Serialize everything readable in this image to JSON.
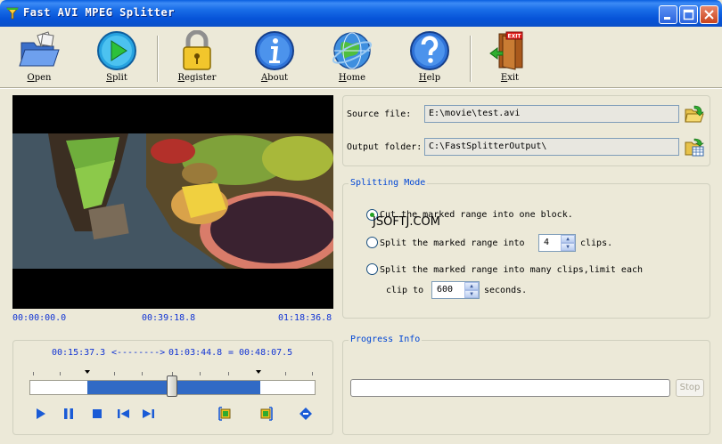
{
  "window": {
    "title": "Fast AVI MPEG Splitter"
  },
  "toolbar": {
    "open": "Open",
    "split": "Split",
    "register": "Register",
    "about": "About",
    "home": "Home",
    "help": "Help",
    "exit": "Exit",
    "exit_sign": "EXIT"
  },
  "player": {
    "time_start": "00:00:00.0",
    "time_current": "00:39:18.8",
    "time_end": "01:18:36.8"
  },
  "files": {
    "source_label": "Source file:",
    "source_value": "E:\\movie\\test.avi",
    "output_label": "Output folder:",
    "output_value": "C:\\FastSplitterOutput\\"
  },
  "mode": {
    "legend": "Splitting Mode",
    "opt1": "Cut the marked range into one block.",
    "opt2_prefix": "Split the marked range into",
    "opt2_value": "4",
    "opt2_suffix": "clips.",
    "opt3_line1": "Split the marked range into many clips,limit each",
    "opt3_prefix": "clip to",
    "opt3_value": "600",
    "opt3_suffix": "seconds.",
    "selected": 1
  },
  "watermark": "JSOFTJ.COM",
  "range": {
    "start": "00:15:37.3",
    "arrow": "<-------->",
    "end": "01:03:44.8",
    "eq": "=",
    "length": "00:48:07.5"
  },
  "progress": {
    "legend": "Progress Info",
    "stop_label": "Stop",
    "value": 0
  },
  "colors": {
    "accent": "#0046d5",
    "time_text": "#1033d4",
    "range_fill": "#316ac5"
  }
}
